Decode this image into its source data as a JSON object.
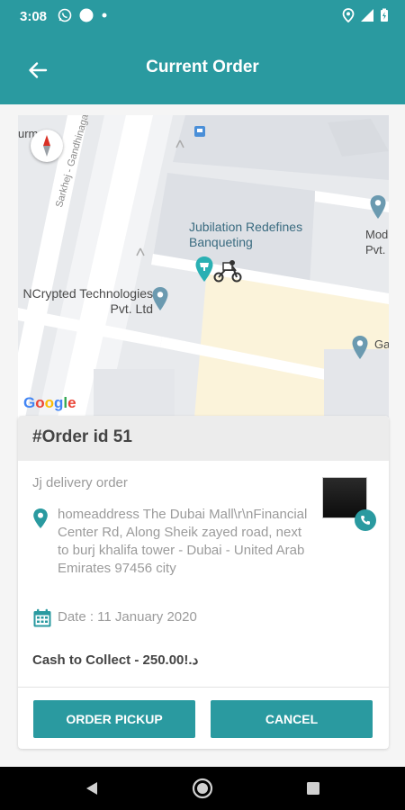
{
  "status_bar": {
    "time": "3:08",
    "icons_left": [
      "whatsapp-icon",
      "circle-notification-icon",
      "dot-icon"
    ],
    "icons_right": [
      "location-icon",
      "signal-icon",
      "battery-icon"
    ]
  },
  "app_bar": {
    "title": "Current Order",
    "back_icon": "arrow-left-icon"
  },
  "map": {
    "labels": {
      "poi_main": "Jubilation Redefines Banqueting",
      "poi_ncrypted": "NCrypted Technologies Pvt. Ltd",
      "road": "Sarkhej - Gandhinagar Hwy",
      "edge_top_left": "urm",
      "edge_right_1": "Mod Pvt.",
      "edge_right_2": "Ga"
    },
    "google": [
      "G",
      "o",
      "o",
      "g",
      "l",
      "e"
    ],
    "colors": {
      "background": "#e8eaed",
      "road": "#ffffff",
      "pin": "#6b9ab0",
      "accent": "#2a9aa0"
    }
  },
  "order": {
    "id_label": "#Order id 51",
    "name": "Jj delivery order",
    "address": "homeaddress The Dubai Mall\\r\\nFinancial Center Rd, Along Sheik zayed road, next to burj khalifa tower - Dubai - United Arab Emirates 97456 city",
    "date": "Date : 11 January 2020",
    "cash": "Cash to Collect - 250.00!.د"
  },
  "actions": {
    "pickup": "ORDER PICKUP",
    "cancel": "CANCEL"
  },
  "theme": {
    "primary": "#2a9aa0"
  }
}
